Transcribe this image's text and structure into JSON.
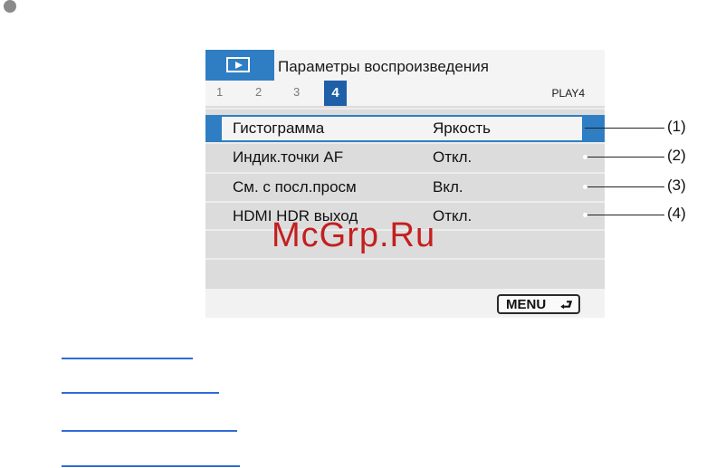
{
  "header": {
    "title": "Параметры воспроизведения",
    "tabs": [
      "1",
      "2",
      "3",
      "4"
    ],
    "active_tab": "4",
    "page_code": "PLAY4"
  },
  "menu": {
    "items": [
      {
        "label": "Гистограмма",
        "value": "Яркость"
      },
      {
        "label": "Индик.точки AF",
        "value": "Откл."
      },
      {
        "label": "См. с посл.просм",
        "value": "Вкл."
      },
      {
        "label": "HDMI HDR выход",
        "value": "Откл."
      }
    ]
  },
  "footer": {
    "menu_label": "MENU",
    "back_icon": "return-arrow-icon"
  },
  "callouts": [
    "(1)",
    "(2)",
    "(3)",
    "(4)"
  ],
  "watermark": "McGrp.Ru",
  "colors": {
    "accent": "#2f7ec4",
    "active_tab": "#1f5fa8",
    "watermark": "#c41f1f",
    "link": "#2f6bd8"
  }
}
